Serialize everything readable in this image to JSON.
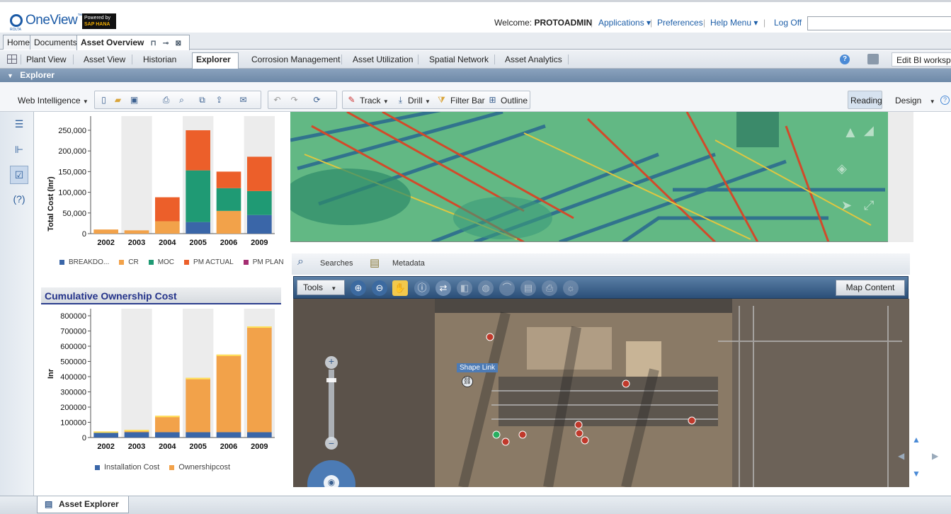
{
  "header": {
    "logo_text": "OneView",
    "logo_tm": "™",
    "logo_sub": "ROLTA",
    "sap_powered": "Powered by",
    "sap_name": "SAP HANA",
    "welcome_prefix": "Welcome:",
    "username": "PROTOADMIN",
    "links": [
      "Applications ▾",
      "Preferences",
      "Help Menu ▾",
      "Log Off"
    ],
    "search_value": ""
  },
  "tabs1": [
    {
      "label": "Home"
    },
    {
      "label": "Documents"
    },
    {
      "label": "Asset Overview"
    }
  ],
  "tabs2": [
    {
      "label": "Plant View"
    },
    {
      "label": "Asset View"
    },
    {
      "label": "Historian"
    },
    {
      "label": "Explorer"
    },
    {
      "label": "Corrosion Management"
    },
    {
      "label": "Asset Utilization"
    },
    {
      "label": "Spatial Network"
    },
    {
      "label": "Asset Analytics"
    }
  ],
  "edit_bi": "Edit BI workspace",
  "explorer_title": "Explorer",
  "toolbar": {
    "web_intelligence": "Web Intelligence",
    "track": "Track",
    "drill": "Drill",
    "filter_bar": "Filter Bar",
    "outline": "Outline",
    "reading": "Reading",
    "design": "Design"
  },
  "chart_data": [
    {
      "type": "bar",
      "stacked": true,
      "categories": [
        "2002",
        "2003",
        "2004",
        "2005",
        "2006",
        "2009"
      ],
      "ylabel": "Total Cost (Inr)",
      "ylim": [
        0,
        250000
      ],
      "ytick_labels": [
        "0",
        "50,000",
        "100,000",
        "150,000",
        "200,000",
        "250,000"
      ],
      "series": [
        {
          "name": "BREAKDO...",
          "color": "#3a66a8",
          "values": [
            0,
            0,
            0,
            28000,
            0,
            45000
          ]
        },
        {
          "name": "CR",
          "color": "#f2a24a",
          "values": [
            10000,
            8000,
            30000,
            0,
            55000,
            0
          ]
        },
        {
          "name": "MOC",
          "color": "#1f9a74",
          "values": [
            0,
            0,
            0,
            125000,
            55000,
            58000
          ]
        },
        {
          "name": "PM ACTUAL",
          "color": "#ec5f2a",
          "values": [
            0,
            0,
            58000,
            97000,
            40000,
            83000
          ]
        },
        {
          "name": "PM PLAN",
          "color": "#a52d72",
          "values": [
            0,
            0,
            0,
            0,
            0,
            0
          ]
        }
      ]
    },
    {
      "type": "bar",
      "stacked": true,
      "title": "Cumulative Ownership Cost",
      "categories": [
        "2002",
        "2003",
        "2004",
        "2005",
        "2006",
        "2009"
      ],
      "ylabel": "Inr",
      "ylim": [
        0,
        800000
      ],
      "ytick_labels": [
        "0",
        "100000",
        "200000",
        "300000",
        "400000",
        "500000",
        "600000",
        "700000",
        "800000"
      ],
      "series": [
        {
          "name": "Installation Cost",
          "color": "#3a66a8",
          "values": [
            35000,
            35000,
            35000,
            35000,
            35000,
            35000
          ]
        },
        {
          "name": "Ownershipcost",
          "color": "#f2a24a",
          "values": [
            5000,
            15000,
            108000,
            357000,
            510000,
            695000
          ]
        }
      ]
    }
  ],
  "search_bar": {
    "searches": "Searches",
    "metadata": "Metadata"
  },
  "map": {
    "tools": "Tools",
    "map_content": "Map Content",
    "shape_link": "Shape Link"
  },
  "bottom": {
    "asset_explorer": "Asset Explorer"
  }
}
